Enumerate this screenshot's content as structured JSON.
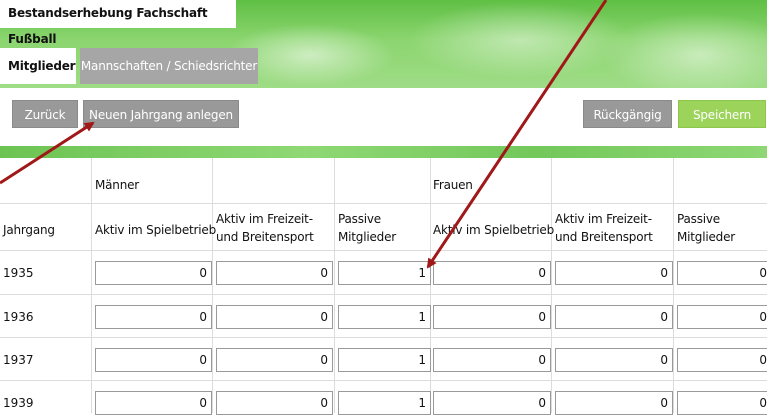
{
  "window": {
    "title": "Bestandserhebung Fachschaft Fußball"
  },
  "tabs": [
    {
      "label": "Mitglieder",
      "active": true
    },
    {
      "label": "Mannschaften / Schiedsrichter",
      "active": false
    }
  ],
  "toolbar": {
    "back_label": "Zurück",
    "new_year_label": "Neuen Jahrgang anlegen",
    "undo_label": "Rückgängig",
    "save_label": "Speichern"
  },
  "table": {
    "group_headers": {
      "men": "Männer",
      "women": "Frauen"
    },
    "year_header": "Jahrgang",
    "columns": {
      "active_play": "Aktiv im Spielbetrieb",
      "active_leisure_line1": "Aktiv im Freizeit-",
      "active_leisure_line2": "und Breitensport",
      "passive_line1": "Passive",
      "passive_line2": "Mitglieder"
    },
    "rows": [
      {
        "year": "1935",
        "values": [
          "0",
          "0",
          "1",
          "0",
          "0",
          "0"
        ]
      },
      {
        "year": "1936",
        "values": [
          "0",
          "0",
          "1",
          "0",
          "0",
          "0"
        ]
      },
      {
        "year": "1937",
        "values": [
          "0",
          "0",
          "1",
          "0",
          "0",
          "0"
        ]
      },
      {
        "year": "1939",
        "values": [
          "0",
          "0",
          "1",
          "0",
          "0",
          "0"
        ]
      }
    ]
  },
  "colors": {
    "accent_green": "#9cd35a",
    "button_gray": "#999999",
    "annotation_arrow": "#a01818"
  }
}
